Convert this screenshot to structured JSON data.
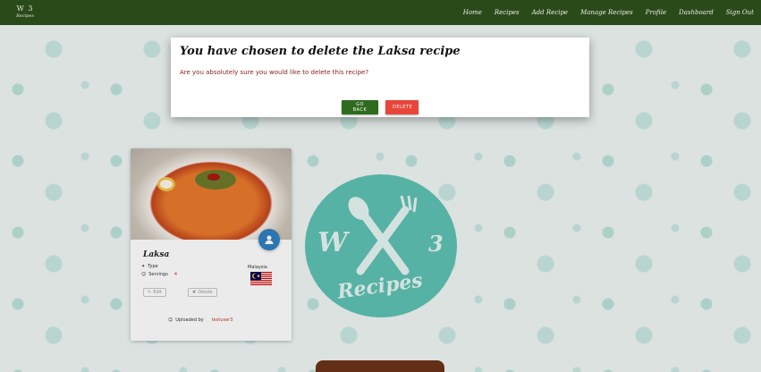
{
  "navbar": {
    "brand": {
      "mark": "W 3",
      "sub": "Recipes"
    },
    "links": [
      "Home",
      "Recipes",
      "Add Recipe",
      "Manage Recipes",
      "Profile",
      "Dashboard",
      "Sign Out"
    ]
  },
  "recipe_card": {
    "title": "Laksa",
    "type_label": "Type",
    "servings_label": "Servings",
    "servings_value": "4",
    "country": "Malaysia",
    "edit_label": "Edit",
    "delete_label": "Delete",
    "uploaded_by_label": "Uploaded by",
    "uploaded_by_user": "testuser3"
  },
  "modal": {
    "title": "You have chosen to delete the Laksa recipe",
    "message": "Are you absolutely sure you would like to delete this recipe?",
    "back_button": "GO BACK",
    "delete_button": "DELETE"
  },
  "colors": {
    "navbar": "#2b4a1a",
    "back_button": "#2e6b1e",
    "delete_button": "#e9463b",
    "logo_circle": "#5ec2b2"
  }
}
